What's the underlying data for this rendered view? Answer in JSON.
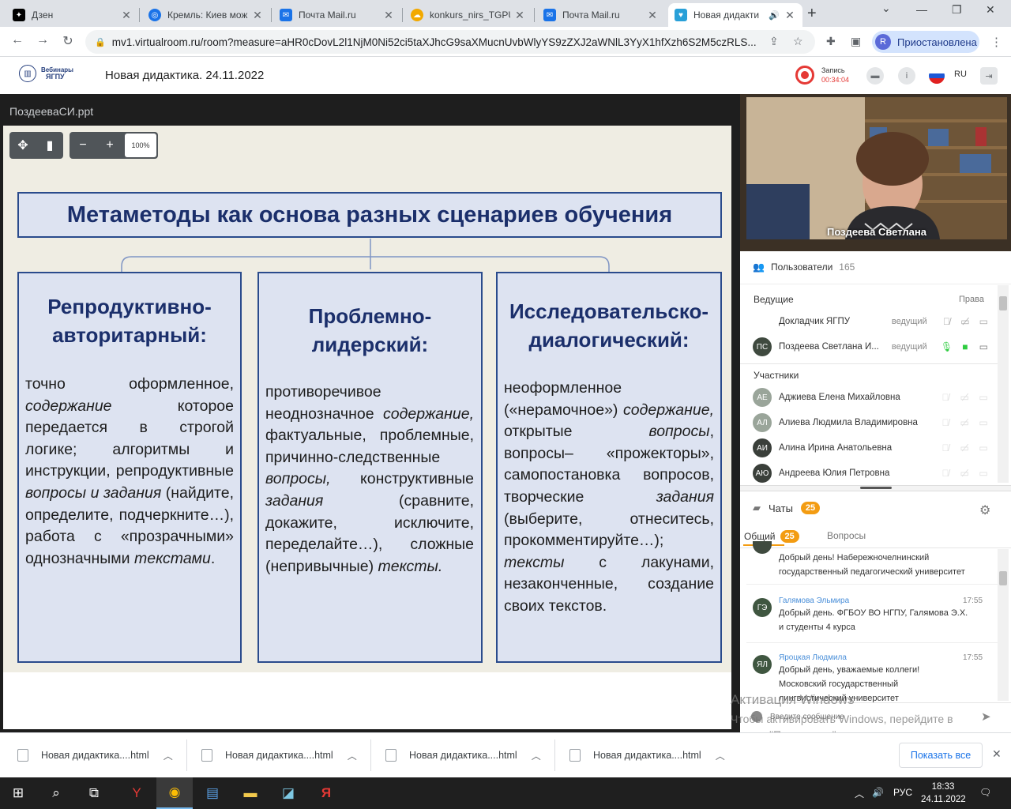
{
  "browser": {
    "tabs": [
      {
        "title": "Дзен",
        "icon": "zen-icon",
        "color": "#000000"
      },
      {
        "title": "Кремль: Киев мож",
        "icon": "news-icon",
        "color": "#1a73e8"
      },
      {
        "title": "Почта Mail.ru",
        "icon": "mail-icon",
        "color": "#1a73e8"
      },
      {
        "title": "konkurs_nirs_TGPU",
        "icon": "cloud-icon",
        "color": "#f2a900"
      },
      {
        "title": "Почта Mail.ru",
        "icon": "mail-icon",
        "color": "#1a73e8"
      },
      {
        "title": "Новая дидакти",
        "icon": "virtualroom-icon",
        "color": "#29a0d8"
      }
    ],
    "url": "mv1.virtualroom.ru/room?measure=aHR0cDovL2l1NjM0Ni52ci5taXJhcG9saXMucnUvbWlyYS9zZXJ2aWNlL3YyX1hfXzh6S2M5czRLS...",
    "profile_initial": "R",
    "profile_label": "Приостановлена"
  },
  "app": {
    "logo_line1": "Вебинары",
    "logo_line2": "ЯГПУ",
    "title": "Новая дидактика. 24.11.2022",
    "record_label": "Запись",
    "record_time": "00:34:04",
    "lang": "RU"
  },
  "presentation": {
    "filename": "ПоздееваСИ.ppt",
    "zoom": "100%",
    "slide_title": "Метаметоды как основа разных сценариев обучения",
    "columns": [
      {
        "head": "Репродуктивно-авторитарный:",
        "segments": [
          {
            "t": "точно оформленное, ",
            "i": false
          },
          {
            "t": "содержание",
            "i": true
          },
          {
            "t": " которое передается в строгой логике; алгоритмы и инструкции, репродуктивные ",
            "i": false
          },
          {
            "t": "вопросы и задания",
            "i": true
          },
          {
            "t": " (найдите, определите, подчеркните…), работа с «прозрачными» однозначными ",
            "i": false
          },
          {
            "t": "текстами",
            "i": true
          },
          {
            "t": ".",
            "i": false
          }
        ]
      },
      {
        "head": "Проблемно-лидерский:",
        "segments": [
          {
            "t": "противоречивое неоднозначное ",
            "i": false
          },
          {
            "t": "содержание,",
            "i": true
          },
          {
            "t": " фактуальные, проблемные, причинно-следственные ",
            "i": false
          },
          {
            "t": "вопросы,",
            "i": true
          },
          {
            "t": " конструктивные ",
            "i": false
          },
          {
            "t": "задания",
            "i": true
          },
          {
            "t": " (сравните, докажите, исключите, переделайте…), сложные (непривычные) ",
            "i": false
          },
          {
            "t": "тексты.",
            "i": true
          }
        ]
      },
      {
        "head": "Исследовательско-диалогический:",
        "segments": [
          {
            "t": "неоформленное («нерамочное») ",
            "i": false
          },
          {
            "t": "содержание,",
            "i": true
          },
          {
            "t": " открытые ",
            "i": false
          },
          {
            "t": "вопросы",
            "i": true
          },
          {
            "t": ", вопросы– «прожекторы», самопостановка вопросов, творческие ",
            "i": false
          },
          {
            "t": "задания",
            "i": true
          },
          {
            "t": " (выберите, отнеситесь, прокомментируйте…); ",
            "i": false
          },
          {
            "t": "тексты",
            "i": true
          },
          {
            "t": " с лакунами, незаконченные, создание своих текстов.",
            "i": false
          }
        ]
      }
    ]
  },
  "video": {
    "speaker_name": "Поздеева Светлана"
  },
  "users": {
    "header": "Пользователи",
    "count": "165",
    "hosts_label": "Ведущие",
    "rights_label": "Права",
    "hosts": [
      {
        "initials": "",
        "name": "Докладчик ЯГПУ",
        "role": "ведущий",
        "mic": "off",
        "cam": "off"
      },
      {
        "initials": "ПС",
        "name": "Поздеева Светлана И...",
        "role": "ведущий",
        "mic": "on",
        "cam": "on"
      }
    ],
    "participants_label": "Участники",
    "participants": [
      {
        "initials": "АЕ",
        "name": "Аджиева Елена Михайловна",
        "color": "#9aa59a"
      },
      {
        "initials": "АЛ",
        "name": "Алиева Людмила Владимировна",
        "color": "#9aa59a"
      },
      {
        "initials": "АИ",
        "name": "Алина Ирина Анатольевна",
        "color": "#3a3f3a"
      },
      {
        "initials": "АЮ",
        "name": "Андреева Юлия Петровна",
        "color": "#3a3f3a"
      }
    ]
  },
  "chats": {
    "header": "Чаты",
    "count": "25",
    "tab_general": "Общий",
    "tab_general_count": "25",
    "tab_questions": "Вопросы",
    "messages": [
      {
        "initials": "",
        "name": "",
        "time": "",
        "text": [
          "Добрый день! Набережночелнинский",
          "государственный педагогический университет"
        ]
      },
      {
        "initials": "ГЭ",
        "name": "Галямова Эльмира",
        "time": "17:55",
        "text": [
          "Добрый день. ФГБОУ ВО НГПУ, Галямова Э.Х.",
          "и студенты 4 курса"
        ]
      },
      {
        "initials": "ЯЛ",
        "name": "Яроцкая Людмила",
        "time": "17:55",
        "text": [
          "Добрый день, уважаемые коллеги!",
          "Московский государственный",
          "лингвистический университет"
        ]
      }
    ],
    "input_placeholder": "Введите сообщение"
  },
  "watermark": {
    "line1": "Активация Windows",
    "line2": "Чтобы активировать Windows, перейдите в раздел \"Параметры\"."
  },
  "downloads": {
    "items": [
      "Новая дидактика....html",
      "Новая дидактика....html",
      "Новая дидактика....html",
      "Новая дидактика....html"
    ],
    "show_all": "Показать все"
  },
  "taskbar": {
    "lang": "РУС",
    "time": "18:33",
    "date": "24.11.2022"
  }
}
